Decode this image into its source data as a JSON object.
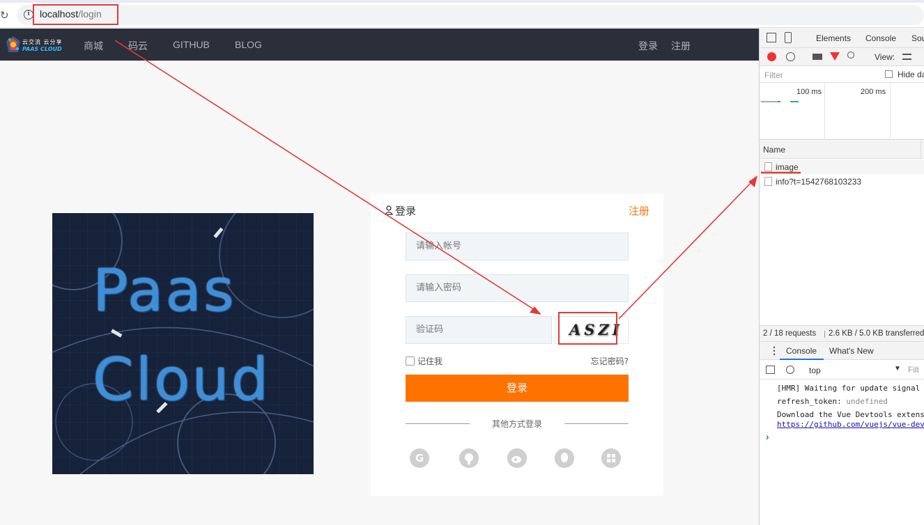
{
  "browser": {
    "url_host": "localhost",
    "url_path": "/login"
  },
  "site_nav": {
    "logo_line1": "云交流 云分享",
    "logo_line2": "PAAS CLOUD",
    "links": [
      "商城",
      "码云",
      "GITHUB",
      "BLOG"
    ],
    "right_links": [
      "登录",
      "注册"
    ]
  },
  "hero": {
    "line1": "Paas",
    "line2": "Cloud"
  },
  "login_card": {
    "title": "登录",
    "register_link": "注册",
    "account_placeholder": "请输入帐号",
    "password_placeholder": "请输入密码",
    "captcha_placeholder": "验证码",
    "captcha_text": "ASZI",
    "remember_label": "记住我",
    "forgot_label": "忘记密码?",
    "submit_label": "登录",
    "other_login_label": "其他方式登录",
    "social_icons": [
      "gitee-icon",
      "github-icon",
      "weibo-icon",
      "qq-icon",
      "windows-icon"
    ]
  },
  "devtools": {
    "tabs": [
      "Elements",
      "Console",
      "Sou"
    ],
    "view_label": "View:",
    "filter_placeholder": "Filter",
    "hide_label": "Hide da",
    "timeline_labels": [
      "100 ms",
      "200 ms"
    ],
    "name_header": "Name",
    "requests": [
      "image",
      "info?t=1542768103233"
    ],
    "status": "2 / 18 requests",
    "transfer": "2.6 KB / 5.0 KB transferred",
    "drawer_tabs": [
      "Console",
      "What's New"
    ],
    "context": "top",
    "console_filter": "Filt",
    "logs": [
      "[HMR] Waiting for update signal",
      "refresh_token:",
      "Download the Vue Devtools extens",
      "https://github.com/vuejs/vue-dev"
    ],
    "log_value": "undefined",
    "prompt": "›"
  },
  "colors": {
    "accent": "#fe7300",
    "annotation": "#e23a3a",
    "nav_bg": "#2b2f3a"
  }
}
